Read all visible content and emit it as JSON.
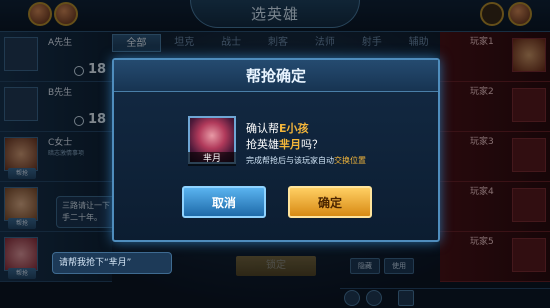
{
  "header": {
    "title": "选英雄"
  },
  "tabs": [
    "全部",
    "坦克",
    "战士",
    "刺客",
    "法师",
    "射手",
    "辅助"
  ],
  "left_players": [
    {
      "name": "A先生",
      "timer": "18"
    },
    {
      "name": "B先生",
      "timer": "18"
    },
    {
      "name": "C女士",
      "sub": "暗志激情事项",
      "help": "帮抢"
    },
    {
      "help": "帮抢"
    },
    {
      "help": "帮抢"
    }
  ],
  "chats": {
    "c_msg": "三路请让一下\n手二十年。",
    "d_msg": "请帮我抢下“芈月”"
  },
  "right_players": [
    "玩家1",
    "玩家2",
    "玩家3",
    "玩家4",
    "玩家5"
  ],
  "bottom": {
    "confirm": "锁定",
    "btn1": "隐藏",
    "btn2": "使用"
  },
  "modal": {
    "title": "帮抢确定",
    "hero_name": "芈月",
    "line1_prefix": "确认帮",
    "line1_target": "E小孩",
    "line2_prefix": "抢英雄",
    "line2_hero": "芈月",
    "line2_suffix": "吗？",
    "note_prefix": "完成帮抢后与该玩家自动",
    "note_accent": "交换位置",
    "cancel_label": "取消",
    "ok_label": "确定"
  }
}
